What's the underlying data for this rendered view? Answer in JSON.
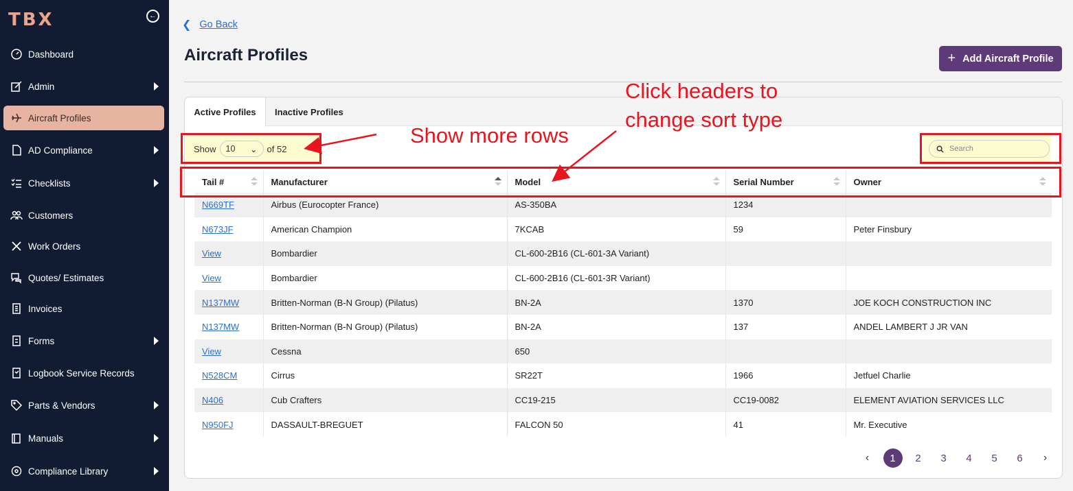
{
  "app": {
    "logo": "TBX",
    "collapse_icon": "arrow-left-circle-icon"
  },
  "sidebar": {
    "items": [
      {
        "label": "Dashboard",
        "icon": "gauge-icon",
        "has_submenu": false,
        "active": false
      },
      {
        "label": "Admin",
        "icon": "edit-icon",
        "has_submenu": true,
        "active": false
      },
      {
        "label": "Aircraft Profiles",
        "icon": "plane-icon",
        "has_submenu": false,
        "active": true
      },
      {
        "label": "AD Compliance",
        "icon": "document-icon",
        "has_submenu": true,
        "active": false
      },
      {
        "label": "Checklists",
        "icon": "checklist-icon",
        "has_submenu": true,
        "active": false
      },
      {
        "label": "Customers",
        "icon": "users-icon",
        "has_submenu": false,
        "active": false
      },
      {
        "label": "Work Orders",
        "icon": "tools-icon",
        "has_submenu": false,
        "active": false
      },
      {
        "label": "Quotes/ Estimates",
        "icon": "quote-icon",
        "has_submenu": false,
        "active": false
      },
      {
        "label": "Invoices",
        "icon": "invoice-icon",
        "has_submenu": false,
        "active": false
      },
      {
        "label": "Forms",
        "icon": "form-icon",
        "has_submenu": true,
        "active": false
      },
      {
        "label": "Logbook Service Records",
        "icon": "logbook-icon",
        "has_submenu": false,
        "active": false
      },
      {
        "label": "Parts & Vendors",
        "icon": "tag-icon",
        "has_submenu": true,
        "active": false
      },
      {
        "label": "Manuals",
        "icon": "book-icon",
        "has_submenu": true,
        "active": false
      },
      {
        "label": "Compliance Library",
        "icon": "library-icon",
        "has_submenu": true,
        "active": false
      }
    ]
  },
  "header": {
    "go_back": "Go Back",
    "title": "Aircraft Profiles",
    "add_button": "Add Aircraft Profile"
  },
  "tabs": [
    {
      "label": "Active Profiles"
    },
    {
      "label": "Inactive Profiles"
    }
  ],
  "controls": {
    "show_label": "Show",
    "page_size": "10",
    "of_total": "of 52",
    "search_placeholder": "Search"
  },
  "table": {
    "columns": [
      "Tail #",
      "Manufacturer",
      "Model",
      "Serial Number",
      "Owner"
    ],
    "sorted_column": "Manufacturer",
    "rows": [
      [
        "N669TF",
        "Airbus (Eurocopter France)",
        "AS-350BA",
        "1234",
        ""
      ],
      [
        "N673JF",
        "American Champion",
        "7KCAB",
        "59",
        "Peter Finsbury"
      ],
      [
        "View",
        "Bombardier",
        "CL-600-2B16 (CL-601-3A Variant)",
        "",
        ""
      ],
      [
        "View",
        "Bombardier",
        "CL-600-2B16 (CL-601-3R Variant)",
        "",
        ""
      ],
      [
        "N137MW",
        "Britten-Norman (B-N Group) (Pilatus)",
        "BN-2A",
        "1370",
        "JOE KOCH CONSTRUCTION INC"
      ],
      [
        "N137MW",
        "Britten-Norman (B-N Group) (Pilatus)",
        "BN-2A",
        "137",
        "ANDEL LAMBERT J JR VAN"
      ],
      [
        "View",
        "Cessna",
        "650",
        "",
        ""
      ],
      [
        "N528CM",
        "Cirrus",
        "SR22T",
        "1966",
        "Jetfuel Charlie"
      ],
      [
        "N406",
        "Cub Crafters",
        "CC19-215",
        "CC19-0082",
        "ELEMENT AVIATION SERVICES LLC"
      ],
      [
        "N950FJ",
        "DASSAULT-BREGUET",
        "FALCON 50",
        "41",
        "Mr. Executive"
      ]
    ]
  },
  "pagination": {
    "pages": [
      "1",
      "2",
      "3",
      "4",
      "5",
      "6"
    ],
    "current": "1",
    "prev": "‹",
    "next": "›"
  },
  "annotations": {
    "show_more": "Show more rows",
    "sort_line1": "Click headers to",
    "sort_line2": "change sort type",
    "color": "#e8141e"
  },
  "colors": {
    "sidebar_bg": "#111c33",
    "accent": "#5e3b78",
    "active_nav": "#e8b4a2",
    "link": "#2a6fd6",
    "highlight": "#fdfbd0"
  }
}
